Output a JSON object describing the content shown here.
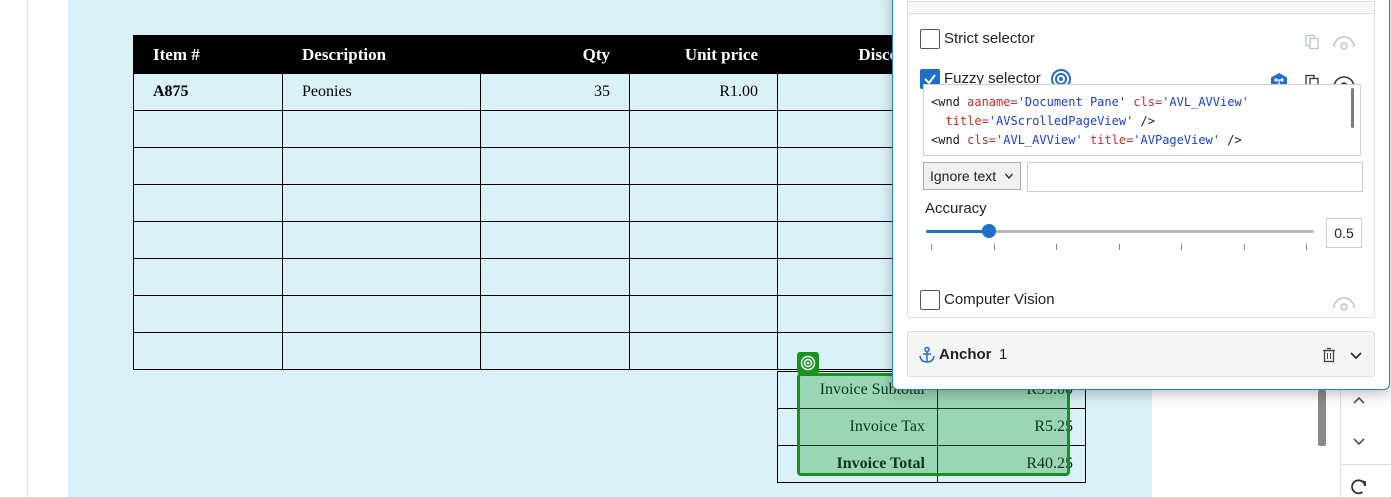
{
  "invoice": {
    "headers": [
      "Item #",
      "Description",
      "Qty",
      "Unit price",
      "Disco"
    ],
    "row1": [
      "A875",
      "Peonies",
      "35",
      "R1.00",
      ""
    ],
    "totals": {
      "subtotal_label": "Invoice Subtotal",
      "subtotal_value": "R35.00",
      "tax_label": "Invoice Tax",
      "tax_value": "R5.25",
      "total_label": "Invoice Total",
      "total_value": "R40.25"
    }
  },
  "selector_editor": {
    "strict_label": "Strict selector",
    "strict_checked": false,
    "fuzzy_label": "Fuzzy selector",
    "fuzzy_checked": true,
    "code": {
      "line1_tag": "<wnd ",
      "line1_attr1": "aaname=",
      "line1_val1": "'Document Pane'",
      "line1_attr2": " cls=",
      "line1_val2": "'AVL_AVView'",
      "line2_attr": "  title=",
      "line2_val": "'AVScrolledPageView'",
      "line2_end": " />",
      "line3_tag": "<wnd ",
      "line3_attr1": "cls=",
      "line3_val1": "'AVL_AVView'",
      "line3_attr2": " title=",
      "line3_val2": "'AVPageView'",
      "line3_end": " />"
    },
    "ignore_text_option": "Ignore text",
    "accuracy_label": "Accuracy",
    "accuracy_value": "0.5",
    "computer_vision_label": "Computer Vision",
    "computer_vision_checked": false
  },
  "anchor": {
    "label": "Anchor",
    "count": "1"
  },
  "colors": {
    "accent": "#1f6fc9",
    "highlight_green": "#17921e",
    "page_background": "#daf2f7"
  }
}
